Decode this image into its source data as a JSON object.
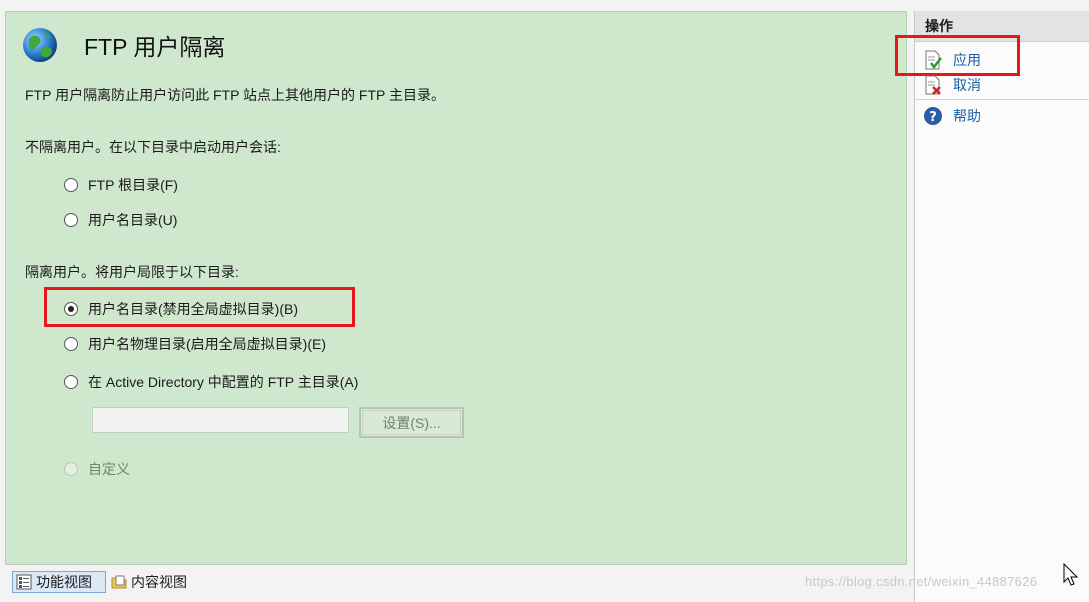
{
  "header": {
    "title": "FTP 用户隔离"
  },
  "description": "FTP 用户隔离防止用户访问此 FTP 站点上其他用户的 FTP 主目录。",
  "no_isolation": {
    "label": "不隔离用户。在以下目录中启动用户会话:",
    "options": [
      "FTP 根目录(F)",
      "用户名目录(U)"
    ]
  },
  "isolation": {
    "label": "隔离用户。将用户局限于以下目录:",
    "options": [
      "用户名目录(禁用全局虚拟目录)(B)",
      "用户名物理目录(启用全局虚拟目录)(E)",
      "在 Active Directory 中配置的 FTP 主目录(A)"
    ],
    "selected": "用户名目录(禁用全局虚拟目录)(B)"
  },
  "ad_settings": {
    "input_value": "",
    "button_label": "设置(S)..."
  },
  "custom_option": "自定义",
  "bottom_tabs": {
    "feature_view": "功能视图",
    "content_view": "内容视图"
  },
  "actions": {
    "header": "操作",
    "apply": "应用",
    "cancel": "取消",
    "help": "帮助"
  },
  "watermark": "https://blog.csdn.net/weixin_44887626",
  "colors": {
    "highlight": "#e6161d",
    "panel_green": "#cfe8cd",
    "link_blue": "#1c5fa5"
  }
}
